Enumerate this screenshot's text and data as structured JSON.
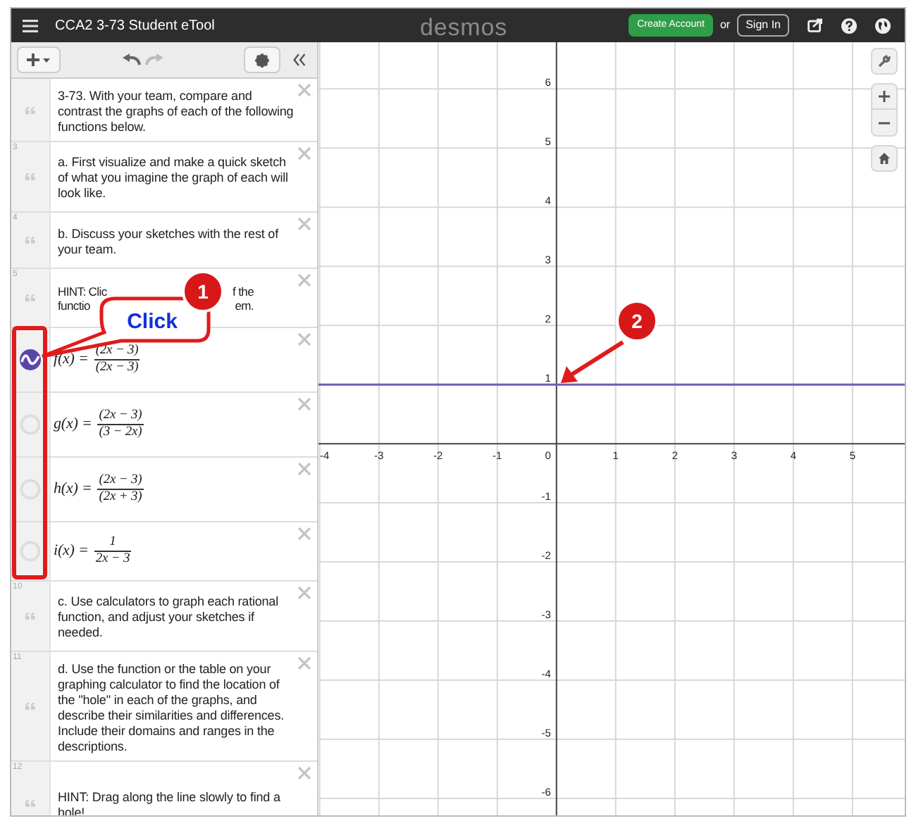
{
  "header": {
    "title": "CCA2 3-73 Student eTool",
    "logo": "desmos",
    "create_account": "Create Account",
    "or": "or",
    "sign_in": "Sign In"
  },
  "expressions": [
    {
      "kind": "note",
      "text": "3-73. With your team, compare and contrast the graphs of each of the following functions below."
    },
    {
      "kind": "note",
      "number": "3",
      "text": "a. First visualize and make a quick sketch of what you imagine the graph of each will look like."
    },
    {
      "kind": "note",
      "number": "4",
      "text": "b. Discuss your sketches with the rest of your team."
    },
    {
      "kind": "covered_note",
      "number": "5",
      "lines": [
        [
          "HINT: Clic",
          "f the"
        ],
        [
          "functio",
          "em."
        ]
      ]
    },
    {
      "kind": "expression",
      "lhs": "f(x) =",
      "numerator": "(2x − 3)",
      "denominator": "(2x − 3)",
      "shown": true
    },
    {
      "kind": "expression",
      "lhs": "g(x) =",
      "numerator": "(2x − 3)",
      "denominator": "(3 − 2x)",
      "shown": false
    },
    {
      "kind": "expression",
      "lhs": "h(x) =",
      "numerator": "(2x − 3)",
      "denominator": "(2x + 3)",
      "shown": false
    },
    {
      "kind": "expression",
      "lhs": "i(x) =",
      "numerator": "1",
      "denominator": "2x − 3",
      "shown": false
    },
    {
      "kind": "note",
      "number": "10",
      "text": "c. Use calculators to graph each rational function, and adjust your sketches if needed."
    },
    {
      "kind": "note",
      "number": "11",
      "text": "d. Use the  function or the table on your graphing calculator to find the location of the \"hole\" in each of the graphs, and describe their similarities and differences. Include their domains and ranges in the descriptions."
    },
    {
      "kind": "note",
      "number": "12",
      "text": "HINT: Drag along the line slowly to find a hole!"
    }
  ],
  "graph": {
    "origin_label": "0",
    "chart_data": {
      "type": "line",
      "x": [
        -4.02,
        5.93
      ],
      "xlim": [
        -4.02,
        5.93
      ],
      "ylim": [
        -6.31,
        6.79
      ],
      "grid": true,
      "series": [
        {
          "color": "#6b5fb5",
          "values": [
            1,
            1
          ]
        }
      ],
      "xticks": [
        -4,
        -3,
        -2,
        -1,
        1,
        2,
        3,
        4,
        5
      ],
      "yticks": [
        -6,
        -5,
        -4,
        -3,
        -2,
        -1,
        1,
        2,
        3,
        4,
        5,
        6
      ]
    }
  },
  "annotations": [
    {
      "kind": "callout",
      "label": "Click"
    },
    {
      "kind": "badge",
      "label": "1"
    },
    {
      "kind": "badge",
      "label": "2"
    }
  ]
}
